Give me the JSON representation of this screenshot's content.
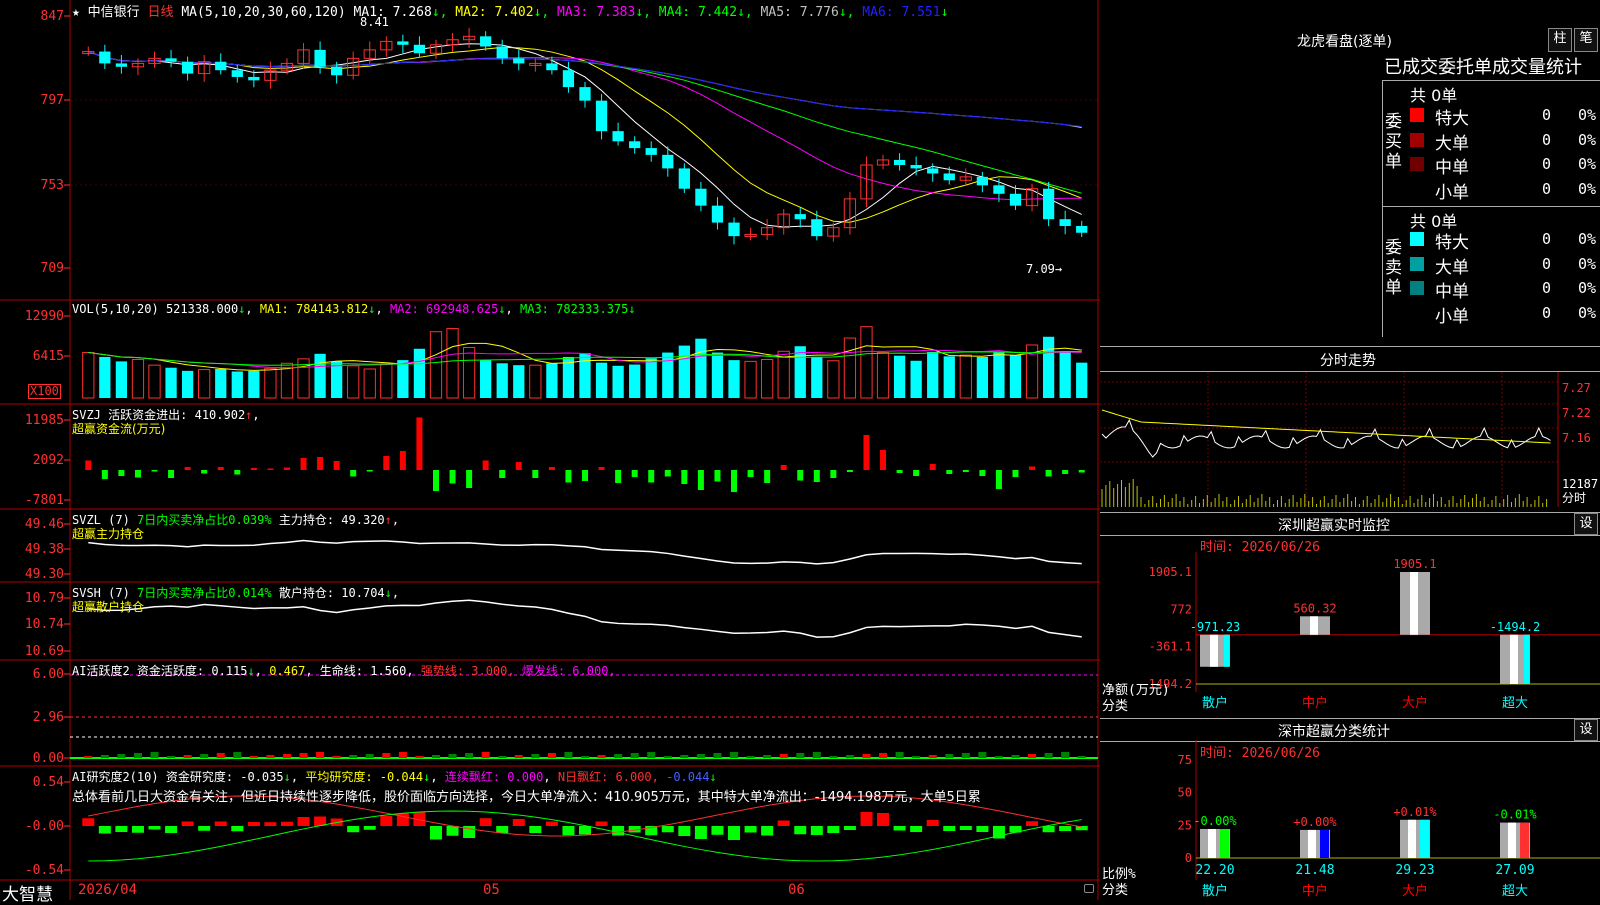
{
  "stock": {
    "name": "中信银行",
    "period": "日线",
    "star": "★"
  },
  "main_panel": {
    "ma_params": "MA(5,10,20,30,60,120)",
    "ma": [
      {
        "label": "MA1:",
        "value": "7.268",
        "arrow": "↓",
        "color": "#ffffff"
      },
      {
        "label": "MA2:",
        "value": "7.402",
        "arrow": "↓",
        "color": "#ffff00"
      },
      {
        "label": "MA3:",
        "value": "7.383",
        "arrow": "↓",
        "color": "#ff00ff"
      },
      {
        "label": "MA4:",
        "value": "7.442",
        "arrow": "↓",
        "color": "#00ff00"
      },
      {
        "label": "MA5:",
        "value": "7.776",
        "arrow": "↓",
        "color": "#c0c0c0"
      },
      {
        "label": "MA6:",
        "value": "7.551",
        "arrow": "↓",
        "color": "#2020ff"
      }
    ],
    "high_label": "8.41",
    "low_label": "7.09→",
    "y_ticks": [
      "847",
      "797",
      "753",
      "709"
    ]
  },
  "vol_panel": {
    "params": "VOL(5,10,20)",
    "value": "521338.000",
    "arrow1": "↓",
    "ma1": "MA1: 784143.812",
    "ma2": "MA2: 692948.625",
    "ma3": "MA3: 782333.375",
    "arrow": "↓",
    "y_ticks": [
      "12990",
      "6415"
    ],
    "unit": "X100"
  },
  "svzj_panel": {
    "name": "SVZJ",
    "title": "活跃资金进出: 410.902",
    "arrow": "↑",
    "sub": "超赢资金流(万元)",
    "y_ticks": [
      "11985",
      "2092",
      "-7801"
    ]
  },
  "svzl_panel": {
    "name": "SVZL (7)",
    "title1": "7日内买卖净占比0.039%",
    "title2": "主力持仓: 49.320",
    "arrow": "↑",
    "sub": "超赢主力持仓",
    "y_ticks": [
      "49.46",
      "49.38",
      "49.30"
    ]
  },
  "svsh_panel": {
    "name": "SVSH (7)",
    "title1": "7日内买卖净占比0.014%",
    "title2": "散户持仓: 10.704",
    "arrow": "↓",
    "sub": "超赢散户持仓",
    "y_ticks": [
      "10.79",
      "10.74",
      "10.69"
    ]
  },
  "ai_active": {
    "name": "AI活跃度2",
    "label": "资金活跃度: 0.115",
    "arrow": "↓",
    "v2": "0.467",
    "life": "生命线: 1.560,",
    "strong": "强势线: 3.000,",
    "burst": "爆发线: 6.000,",
    "y_ticks": [
      "6.00",
      "2.96",
      "0.00"
    ]
  },
  "ai_research": {
    "name": "AI研究度2(10)",
    "label": "资金研究度: -0.035",
    "arrow": "↓",
    "avg": "平均研究度: -0.044",
    "red": "连续飘红: 0.000",
    "n_red": "N日飘红: 6.000,",
    "v5": "-0.044",
    "text": "总体看前几日大资金有关注，但近日持续性逐步降低，股价面临方向选择，今日大单净流入：410.905万元，其中特大单净流出：-1494.198万元，大单5日累",
    "y_ticks": [
      "0.54",
      "-0.00",
      "-0.54"
    ]
  },
  "bottom_bar": {
    "brand": "大智慧",
    "dates": [
      "2026/04",
      "05",
      "06"
    ]
  },
  "right": {
    "dragon_title": "龙虎看盘(逐单)",
    "btn_column": "柱",
    "btn_pen": "笔",
    "tabs": "已成交委托单成交量统计",
    "buy": {
      "side": "委买单",
      "total": "共 0单",
      "rows": [
        {
          "label": "特大",
          "count": "0",
          "pct": "0%",
          "color": "#ff0000"
        },
        {
          "label": "大单",
          "count": "0",
          "pct": "0%",
          "color": "#a00000"
        },
        {
          "label": "中单",
          "count": "0",
          "pct": "0%",
          "color": "#700000"
        },
        {
          "label": "小单",
          "count": "0",
          "pct": "0%",
          "color": "#000000"
        }
      ]
    },
    "sell": {
      "side": "委卖单",
      "total": "共 0单",
      "rows": [
        {
          "label": "特大",
          "count": "0",
          "pct": "0%",
          "color": "#00ffff"
        },
        {
          "label": "大单",
          "count": "0",
          "pct": "0%",
          "color": "#00a0a0"
        },
        {
          "label": "中单",
          "count": "0",
          "pct": "0%",
          "color": "#008080"
        },
        {
          "label": "小单",
          "count": "0",
          "pct": "0%",
          "color": "#000000"
        }
      ]
    },
    "timeshare": {
      "title": "分时走势",
      "y_ticks": [
        "7.27",
        "7.22",
        "7.16",
        "12187",
        "分时"
      ]
    },
    "monitor": {
      "title": "深圳超赢实时监控",
      "btn": "设",
      "time": "时间: 2026/06/26",
      "y_ticks": [
        "1905.1",
        "772",
        "-361.1",
        "-1494.2"
      ],
      "axis": "净额(万元)",
      "cat_label": "分类",
      "bars": [
        {
          "cat": "散户",
          "value": -971.23,
          "label": "-971.23",
          "cat_color": "#00ffff"
        },
        {
          "cat": "中户",
          "value": 560.32,
          "label": "560.32",
          "cat_color": "#ff0000"
        },
        {
          "cat": "大户",
          "value": 1905.1,
          "label": "1905.1",
          "cat_color": "#ff0000"
        },
        {
          "cat": "超大",
          "value": -1494.2,
          "label": "-1494.2",
          "cat_color": "#00ffff"
        }
      ]
    },
    "classify": {
      "title": "深市超赢分类统计",
      "btn": "设",
      "time": "时间: 2026/06/26",
      "y_ticks": [
        "75",
        "50",
        "25",
        "0"
      ],
      "axis": "比例%",
      "cat_label": "分类",
      "bars": [
        {
          "cat": "散户",
          "value": 22.2,
          "top": "-0.00%",
          "bottom": "22.20",
          "color": "#00ff00",
          "cat_color": "#00ffff"
        },
        {
          "cat": "中户",
          "value": 21.48,
          "top": "+0.00%",
          "bottom": "21.48",
          "color": "#0000ff",
          "cat_color": "#ff0000"
        },
        {
          "cat": "大户",
          "value": 29.23,
          "top": "+0.01%",
          "bottom": "29.23",
          "color": "#00ffff",
          "cat_color": "#ff0000"
        },
        {
          "cat": "超大",
          "value": 27.09,
          "top": "-0.01%",
          "bottom": "27.09",
          "color": "#ff3030",
          "cat_color": "#00ffff"
        }
      ]
    }
  },
  "chart_data": {
    "type": "candlestick",
    "ylim": [
      7.0,
      8.5
    ],
    "dates": [
      "2026/04",
      "05",
      "06"
    ],
    "close": [
      8.29,
      8.22,
      8.2,
      8.22,
      8.25,
      8.23,
      8.16,
      8.23,
      8.18,
      8.14,
      8.12,
      8.18,
      8.22,
      8.3,
      8.2,
      8.15,
      8.25,
      8.3,
      8.35,
      8.33,
      8.28,
      8.33,
      8.36,
      8.38,
      8.32,
      8.25,
      8.22,
      8.22,
      8.18,
      8.08,
      8.0,
      7.82,
      7.76,
      7.72,
      7.68,
      7.6,
      7.48,
      7.38,
      7.28,
      7.2,
      7.21,
      7.25,
      7.33,
      7.3,
      7.2,
      7.25,
      7.42,
      7.62,
      7.65,
      7.62,
      7.6,
      7.57,
      7.53,
      7.55,
      7.5,
      7.45,
      7.38,
      7.48,
      7.3,
      7.26,
      7.22
    ],
    "volume_x100": [
      7200,
      6500,
      5800,
      6100,
      5200,
      4800,
      4300,
      4500,
      4600,
      4200,
      4300,
      4700,
      5500,
      6200,
      7000,
      5800,
      5100,
      4600,
      5400,
      6000,
      7800,
      10500,
      11000,
      8000,
      6000,
      5500,
      5200,
      5200,
      5500,
      6500,
      7100,
      5600,
      5100,
      5300,
      6300,
      7200,
      8300,
      9400,
      7200,
      6000,
      5800,
      6100,
      7400,
      8200,
      6500,
      5900,
      9500,
      11300,
      7200,
      6700,
      5900,
      7300,
      6600,
      6800,
      6500,
      7200,
      6800,
      8400,
      9700,
      7400,
      5600
    ],
    "svzj": [
      1900,
      -1800,
      -1200,
      -1500,
      -200,
      -1600,
      600,
      -700,
      600,
      -900,
      400,
      300,
      500,
      2400,
      2600,
      1800,
      -1300,
      -300,
      2800,
      3800,
      10500,
      -4200,
      -2700,
      -3600,
      1900,
      -1600,
      1600,
      -1600,
      600,
      -2500,
      -2200,
      600,
      -2600,
      -1400,
      -2500,
      -1300,
      -2800,
      -4000,
      -2300,
      -4400,
      -1400,
      -2600,
      1000,
      -2100,
      -2400,
      -1600,
      -400,
      7000,
      4000,
      -600,
      -1200,
      1200,
      -800,
      -400,
      -1200,
      -3800,
      -1400,
      700,
      -1300,
      -800,
      -500
    ]
  }
}
